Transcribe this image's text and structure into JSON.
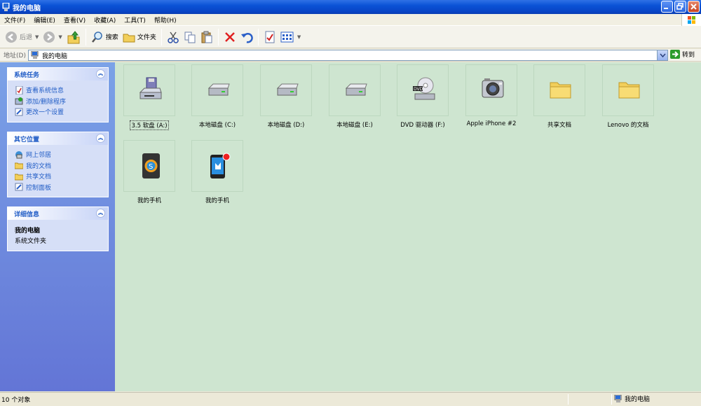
{
  "window": {
    "title": "我的电脑"
  },
  "menu": [
    "文件(F)",
    "编辑(E)",
    "查看(V)",
    "收藏(A)",
    "工具(T)",
    "帮助(H)"
  ],
  "toolbar": {
    "back": "后退",
    "search": "搜索",
    "folders": "文件夹"
  },
  "address": {
    "label": "地址(D)",
    "value": "我的电脑",
    "go": "转到"
  },
  "panels": {
    "system_tasks": {
      "title": "系统任务",
      "items": [
        "查看系统信息",
        "添加/删除程序",
        "更改一个设置"
      ]
    },
    "other_places": {
      "title": "其它位置",
      "items": [
        "网上邻居",
        "我的文档",
        "共享文档",
        "控制面板"
      ]
    },
    "details": {
      "title": "详细信息",
      "name": "我的电脑",
      "type": "系统文件夹"
    }
  },
  "items": [
    {
      "label": "3.5 软盘 (A:)",
      "icon": "floppy-drive-icon"
    },
    {
      "label": "本地磁盘 (C:)",
      "icon": "hard-disk-icon"
    },
    {
      "label": "本地磁盘 (D:)",
      "icon": "hard-disk-icon"
    },
    {
      "label": "本地磁盘 (E:)",
      "icon": "hard-disk-icon"
    },
    {
      "label": "DVD 驱动器 (F:)",
      "icon": "dvd-drive-icon"
    },
    {
      "label": "Apple iPhone #2",
      "icon": "camera-icon"
    },
    {
      "label": "共享文档",
      "icon": "folder-icon"
    },
    {
      "label": "Lenovo 的文档",
      "icon": "folder-icon"
    },
    {
      "label": "我的手机",
      "icon": "phone-icon"
    },
    {
      "label": "我的手机",
      "icon": "phone-icon"
    }
  ],
  "status": {
    "count": "10 个对象",
    "location": "我的电脑"
  }
}
